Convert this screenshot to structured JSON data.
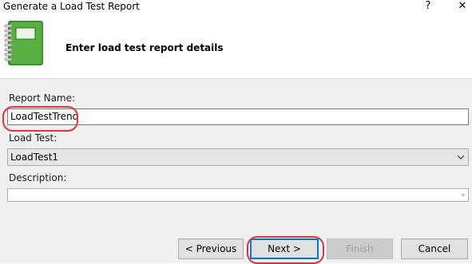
{
  "window": {
    "title": "Generate a Load Test Report",
    "help_glyph": "?",
    "close_glyph": "✕"
  },
  "header": {
    "text": "Enter load test report details",
    "icon": "green-notebook-icon"
  },
  "form": {
    "report_name_label": "Report Name:",
    "report_name_value": "LoadTestTrend",
    "load_test_label": "Load Test:",
    "load_test_value": "LoadTest1",
    "description_label": "Description:",
    "description_value": ""
  },
  "buttons": {
    "previous": "< Previous",
    "next": "Next >",
    "finish": "Finish",
    "cancel": "Cancel"
  },
  "colors": {
    "highlight": "#d9383e",
    "focus_border": "#0078d7",
    "notebook_green": "#4fa33a"
  }
}
